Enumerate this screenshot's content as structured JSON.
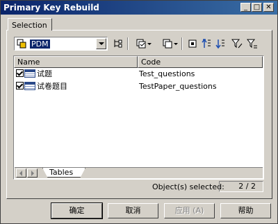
{
  "window": {
    "title": "Primary Key Rebuild",
    "controls": {
      "minimize": "_",
      "maximize": "□",
      "close": "✕"
    }
  },
  "tabs": [
    {
      "label": "Selection"
    }
  ],
  "model_combo": {
    "selected": "PDM",
    "icon": "model-icon"
  },
  "toolbar": {
    "icons": [
      "tree-icon",
      "select-all-icon",
      "deselect-all-icon",
      "filter-icon",
      "move-up-icon",
      "move-down-icon",
      "filter-edit-icon",
      "filter-clear-icon"
    ]
  },
  "list": {
    "columns": [
      "Name",
      "Code"
    ],
    "rows": [
      {
        "name": "试题",
        "code": "Test_questions",
        "checked": true
      },
      {
        "name": "试卷题目",
        "code": "TestPaper_questions",
        "checked": true
      }
    ]
  },
  "sheet_tabs": [
    {
      "label": "Tables"
    }
  ],
  "status": {
    "label": "Object(s) selected:",
    "count": "2 / 2"
  },
  "buttons": {
    "ok": "确定",
    "cancel": "取消",
    "apply": "应用 (A)",
    "help": "帮助"
  }
}
